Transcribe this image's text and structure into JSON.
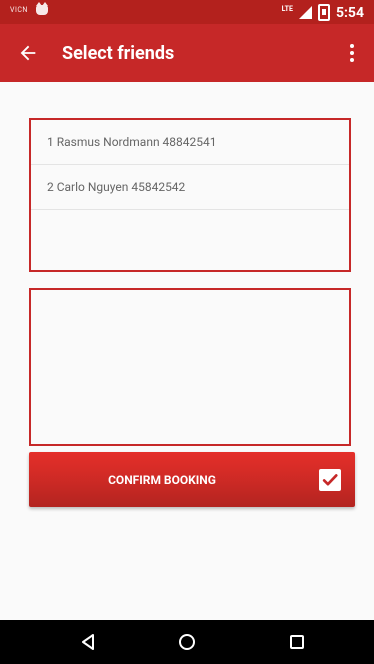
{
  "status_bar": {
    "carrier": "VICN",
    "network": "LTE",
    "time": "5:54"
  },
  "app_bar": {
    "title": "Select friends"
  },
  "friends": [
    "1 Rasmus Nordmann 48842541",
    "2 Carlo Nguyen 45842542"
  ],
  "confirm_button": {
    "label": "CONFIRM BOOKING",
    "checked": true
  }
}
